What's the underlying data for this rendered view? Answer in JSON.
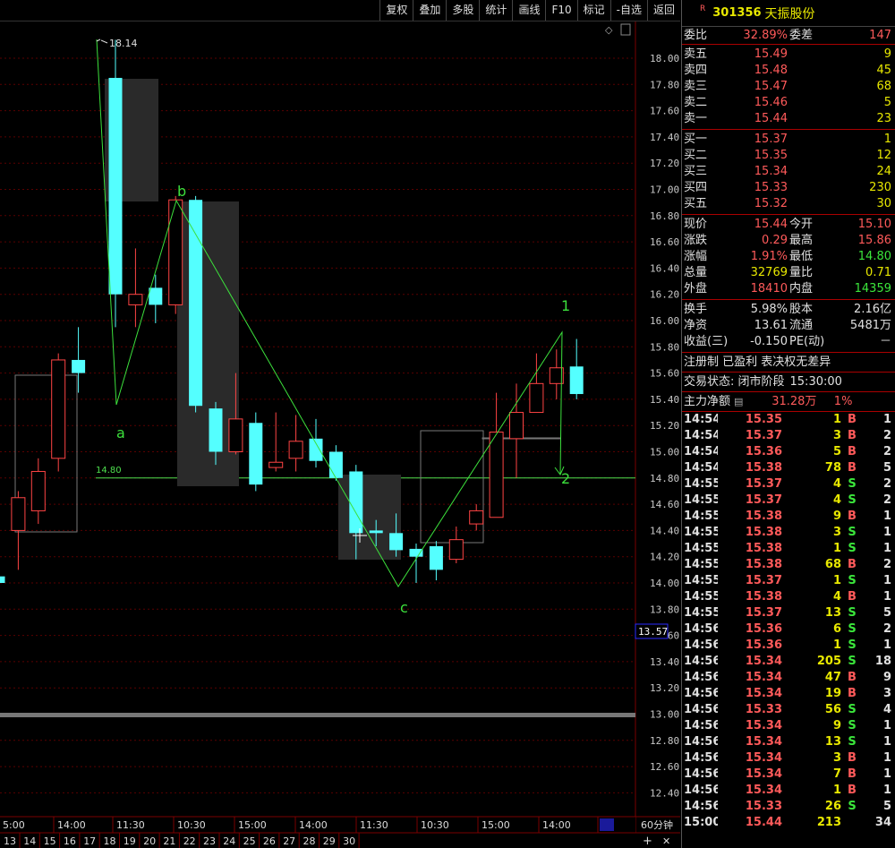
{
  "toolbar": [
    "复权",
    "叠加",
    "多股",
    "统计",
    "画线",
    "F10",
    "标记",
    "-自选",
    "返回"
  ],
  "stock": {
    "mark": "R",
    "code": "301356",
    "name": "天振股份"
  },
  "weibi": {
    "l1": "委比",
    "v1": "32.89%",
    "l2": "委差",
    "v2": "147"
  },
  "sells": [
    {
      "l": "卖五",
      "p": "15.49",
      "v": "9"
    },
    {
      "l": "卖四",
      "p": "15.48",
      "v": "45"
    },
    {
      "l": "卖三",
      "p": "15.47",
      "v": "68"
    },
    {
      "l": "卖二",
      "p": "15.46",
      "v": "5"
    },
    {
      "l": "卖一",
      "p": "15.44",
      "v": "23"
    }
  ],
  "buys": [
    {
      "l": "买一",
      "p": "15.37",
      "v": "1"
    },
    {
      "l": "买二",
      "p": "15.35",
      "v": "12"
    },
    {
      "l": "买三",
      "p": "15.34",
      "v": "24"
    },
    {
      "l": "买四",
      "p": "15.33",
      "v": "230"
    },
    {
      "l": "买五",
      "p": "15.32",
      "v": "30"
    }
  ],
  "stats": [
    {
      "l1": "现价",
      "v1": "15.44",
      "l2": "今开",
      "v2": "15.10"
    },
    {
      "l1": "涨跌",
      "v1": "0.29",
      "l2": "最高",
      "v2": "15.86"
    },
    {
      "l1": "涨幅",
      "v1": "1.91%",
      "l2": "最低",
      "v2": "14.80"
    },
    {
      "l1": "总量",
      "v1": "32769",
      "l2": "量比",
      "v2": "0.71"
    },
    {
      "l1": "外盘",
      "v1": "18410",
      "l2": "内盘",
      "v2": "14359"
    }
  ],
  "stats2": [
    {
      "l1": "换手",
      "v1": "5.98%",
      "l2": "股本",
      "v2": "2.16亿"
    },
    {
      "l1": "净资",
      "v1": "13.61",
      "l2": "流通",
      "v2": "5481万"
    },
    {
      "l1": "收益(三)",
      "v1": "-0.150",
      "l2": "PE(动)",
      "v2": "－"
    }
  ],
  "info1": "注册制 已盈利 表决权无差异",
  "info2": {
    "l": "交易状态: 闭市阶段",
    "v": "15:30:00"
  },
  "mainflow": {
    "l": "主力净额",
    "v": "31.28万",
    "p": "1%"
  },
  "trades": [
    [
      "14:54",
      "15.35",
      "1",
      "B",
      "1"
    ],
    [
      "14:54",
      "15.37",
      "3",
      "B",
      "2"
    ],
    [
      "14:54",
      "15.36",
      "5",
      "B",
      "2"
    ],
    [
      "14:54",
      "15.38",
      "78",
      "B",
      "5"
    ],
    [
      "14:55",
      "15.37",
      "4",
      "S",
      "2"
    ],
    [
      "14:55",
      "15.37",
      "4",
      "S",
      "2"
    ],
    [
      "14:55",
      "15.38",
      "9",
      "B",
      "1"
    ],
    [
      "14:55",
      "15.38",
      "3",
      "S",
      "1"
    ],
    [
      "14:55",
      "15.38",
      "1",
      "S",
      "1"
    ],
    [
      "14:55",
      "15.38",
      "68",
      "B",
      "2"
    ],
    [
      "14:55",
      "15.37",
      "1",
      "S",
      "1"
    ],
    [
      "14:55",
      "15.38",
      "4",
      "B",
      "1"
    ],
    [
      "14:55",
      "15.37",
      "13",
      "S",
      "5"
    ],
    [
      "14:56",
      "15.36",
      "6",
      "S",
      "2"
    ],
    [
      "14:56",
      "15.36",
      "1",
      "S",
      "1"
    ],
    [
      "14:56",
      "15.34",
      "205",
      "S",
      "18"
    ],
    [
      "14:56",
      "15.34",
      "47",
      "B",
      "9"
    ],
    [
      "14:56",
      "15.34",
      "19",
      "B",
      "3"
    ],
    [
      "14:56",
      "15.33",
      "56",
      "S",
      "4"
    ],
    [
      "14:56",
      "15.34",
      "9",
      "S",
      "1"
    ],
    [
      "14:56",
      "15.34",
      "13",
      "S",
      "1"
    ],
    [
      "14:56",
      "15.34",
      "3",
      "B",
      "1"
    ],
    [
      "14:56",
      "15.34",
      "7",
      "B",
      "1"
    ],
    [
      "14:56",
      "15.34",
      "1",
      "B",
      "1"
    ],
    [
      "14:56",
      "15.33",
      "26",
      "S",
      "5"
    ],
    [
      "15:00",
      "15.44",
      "213",
      "",
      "34"
    ]
  ],
  "chart_data": {
    "type": "candlestick",
    "period": "60分钟",
    "yticks": [
      "18.00",
      "17.80",
      "17.60",
      "17.40",
      "17.20",
      "17.00",
      "16.80",
      "16.60",
      "16.40",
      "16.20",
      "16.00",
      "15.80",
      "15.60",
      "15.40",
      "15.20",
      "15.00",
      "14.80",
      "14.60",
      "14.40",
      "14.20",
      "14.00",
      "13.80",
      "13.60",
      "13.40",
      "13.20",
      "13.00",
      "12.80",
      "12.60",
      "12.40"
    ],
    "price_tag": "13.57",
    "level_line": "14.80",
    "high_label": "18.14",
    "time_labels": [
      "5:00",
      "14:00",
      "11:30",
      "10:30",
      "15:00",
      "14:00",
      "11:30",
      "10:30",
      "15:00",
      "14:00",
      "--"
    ],
    "date_labels": [
      "13",
      "14",
      "15",
      "16",
      "17",
      "18",
      "19",
      "20",
      "21",
      "22",
      "23",
      "24",
      "25",
      "26",
      "27",
      "28",
      "29",
      "30"
    ],
    "wave_labels": [
      "a",
      "b",
      "c",
      "1",
      "2"
    ],
    "candles": [
      {
        "o": 14.05,
        "c": 14.0,
        "h": 14.08,
        "l": 13.95,
        "up": false
      },
      {
        "o": 14.4,
        "c": 14.65,
        "h": 14.7,
        "l": 14.1,
        "up": true
      },
      {
        "o": 14.55,
        "c": 14.85,
        "h": 14.95,
        "l": 14.45,
        "up": true
      },
      {
        "o": 14.95,
        "c": 15.7,
        "h": 15.75,
        "l": 14.85,
        "up": true
      },
      {
        "o": 15.6,
        "c": 15.7,
        "h": 15.95,
        "l": 15.45,
        "up": false
      },
      {
        "o": 17.85,
        "c": 16.2,
        "h": 18.14,
        "l": 15.95,
        "up": false
      },
      {
        "o": 16.12,
        "c": 16.2,
        "h": 16.55,
        "l": 15.95,
        "up": true
      },
      {
        "o": 16.25,
        "c": 16.12,
        "h": 16.35,
        "l": 15.98,
        "up": false
      },
      {
        "o": 16.12,
        "c": 16.92,
        "h": 16.95,
        "l": 16.05,
        "up": true
      },
      {
        "o": 16.92,
        "c": 15.35,
        "h": 16.95,
        "l": 15.3,
        "up": false
      },
      {
        "o": 15.33,
        "c": 15.0,
        "h": 15.38,
        "l": 14.9,
        "up": false
      },
      {
        "o": 15.0,
        "c": 15.25,
        "h": 15.6,
        "l": 14.98,
        "up": true
      },
      {
        "o": 15.22,
        "c": 14.75,
        "h": 15.3,
        "l": 14.7,
        "up": false
      },
      {
        "o": 14.92,
        "c": 14.88,
        "h": 15.3,
        "l": 14.85,
        "up": true
      },
      {
        "o": 14.95,
        "c": 15.08,
        "h": 15.28,
        "l": 14.85,
        "up": true
      },
      {
        "o": 15.1,
        "c": 14.93,
        "h": 15.25,
        "l": 14.88,
        "up": false
      },
      {
        "o": 15.0,
        "c": 14.8,
        "h": 15.05,
        "l": 14.78,
        "up": false
      },
      {
        "o": 14.85,
        "c": 14.38,
        "h": 14.9,
        "l": 14.18,
        "up": false
      },
      {
        "o": 14.4,
        "c": 14.38,
        "h": 14.48,
        "l": 14.28,
        "up": false
      },
      {
        "o": 14.38,
        "c": 14.25,
        "h": 14.53,
        "l": 14.2,
        "up": false
      },
      {
        "o": 14.26,
        "c": 14.2,
        "h": 14.3,
        "l": 14.0,
        "up": false
      },
      {
        "o": 14.1,
        "c": 14.28,
        "h": 14.32,
        "l": 14.02,
        "up": false
      },
      {
        "o": 14.18,
        "c": 14.33,
        "h": 14.43,
        "l": 14.15,
        "up": true
      },
      {
        "o": 14.45,
        "c": 14.55,
        "h": 14.6,
        "l": 14.4,
        "up": true
      },
      {
        "o": 14.5,
        "c": 15.15,
        "h": 15.45,
        "l": 14.5,
        "up": true
      },
      {
        "o": 15.1,
        "c": 15.3,
        "h": 15.52,
        "l": 14.8,
        "up": true
      },
      {
        "o": 15.3,
        "c": 15.52,
        "h": 15.75,
        "l": 15.3,
        "up": true
      },
      {
        "o": 15.52,
        "c": 15.64,
        "h": 15.78,
        "l": 15.4,
        "up": true
      },
      {
        "o": 15.65,
        "c": 15.44,
        "h": 15.86,
        "l": 15.4,
        "up": false
      }
    ]
  }
}
